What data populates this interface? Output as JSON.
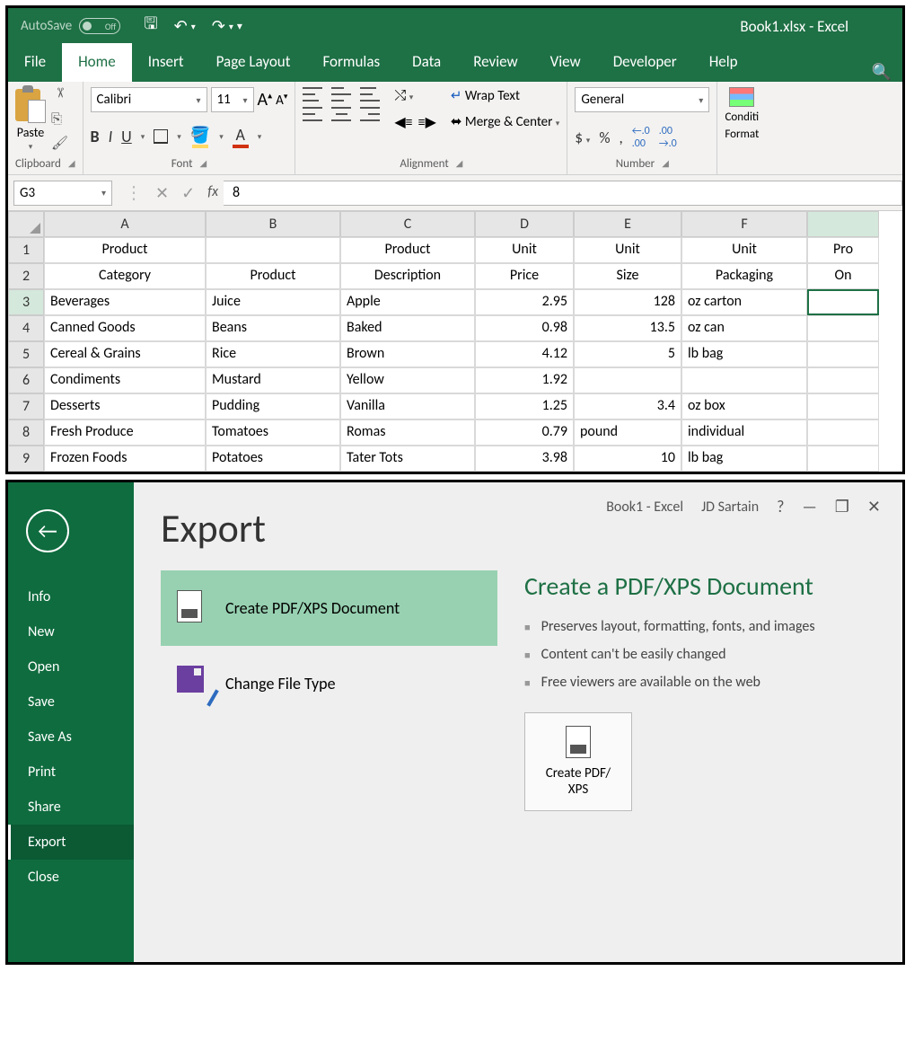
{
  "window1": {
    "autosave_label": "AutoSave",
    "autosave_state": "Off",
    "title": "Book1.xlsx  -  Excel",
    "tabs": [
      "File",
      "Home",
      "Insert",
      "Page Layout",
      "Formulas",
      "Data",
      "Review",
      "View",
      "Developer",
      "Help"
    ],
    "active_tab": "Home",
    "ribbon": {
      "clipboard": {
        "paste": "Paste",
        "group": "Clipboard"
      },
      "font": {
        "name": "Calibri",
        "size": "11",
        "group": "Font"
      },
      "alignment": {
        "wrap": "Wrap Text",
        "merge": "Merge & Center",
        "group": "Alignment"
      },
      "number": {
        "format": "General",
        "group": "Number"
      },
      "cf": {
        "label1": "Conditi",
        "label2": "Format"
      }
    },
    "formula_bar": {
      "name_box": "G3",
      "value": "8"
    },
    "columns": [
      "A",
      "B",
      "C",
      "D",
      "E",
      "F",
      ""
    ],
    "header1": [
      "Product",
      "",
      "Product",
      "Unit",
      "Unit",
      "Unit",
      "Pro"
    ],
    "header2": [
      "Category",
      "Product",
      "Description",
      "Price",
      "Size",
      "Packaging",
      "On"
    ],
    "rows": [
      {
        "n": "3",
        "a": "Beverages",
        "b": "Juice",
        "c": "Apple",
        "d": "2.95",
        "e": "128",
        "f": "oz carton",
        "g": ""
      },
      {
        "n": "4",
        "a": "Canned Goods",
        "b": "Beans",
        "c": "Baked",
        "d": "0.98",
        "e": "13.5",
        "f": "oz can",
        "g": ""
      },
      {
        "n": "5",
        "a": "Cereal & Grains",
        "b": "Rice",
        "c": "Brown",
        "d": "4.12",
        "e": "5",
        "f": "lb bag",
        "g": ""
      },
      {
        "n": "6",
        "a": "Condiments",
        "b": "Mustard",
        "c": "Yellow",
        "d": "1.92",
        "e": "",
        "f": "",
        "g": ""
      },
      {
        "n": "7",
        "a": "Desserts",
        "b": "Pudding",
        "c": "Vanilla",
        "d": "1.25",
        "e": "3.4",
        "f": "oz box",
        "g": ""
      },
      {
        "n": "8",
        "a": "Fresh Produce",
        "b": "Tomatoes",
        "c": "Romas",
        "d": "0.79",
        "e": "pound",
        "f": "individual",
        "g": ""
      },
      {
        "n": "9",
        "a": "Frozen Foods",
        "b": "Potatoes",
        "c": "Tater Tots",
        "d": "3.98",
        "e": "10",
        "f": "lb bag",
        "g": ""
      }
    ]
  },
  "window2": {
    "doc_title": "Book1  -  Excel",
    "user": "JD Sartain",
    "nav": [
      "Info",
      "New",
      "Open",
      "Save",
      "Save As",
      "Print",
      "Share",
      "Export",
      "Close"
    ],
    "active_nav": "Export",
    "page_title": "Export",
    "options": [
      {
        "label": "Create PDF/XPS Document"
      },
      {
        "label": "Change File Type"
      }
    ],
    "detail": {
      "title": "Create a PDF/XPS Document",
      "bullets": [
        "Preserves layout, formatting, fonts, and images",
        "Content can't be easily changed",
        "Free viewers are available on the web"
      ],
      "button_l1": "Create PDF/",
      "button_l2": "XPS"
    }
  }
}
